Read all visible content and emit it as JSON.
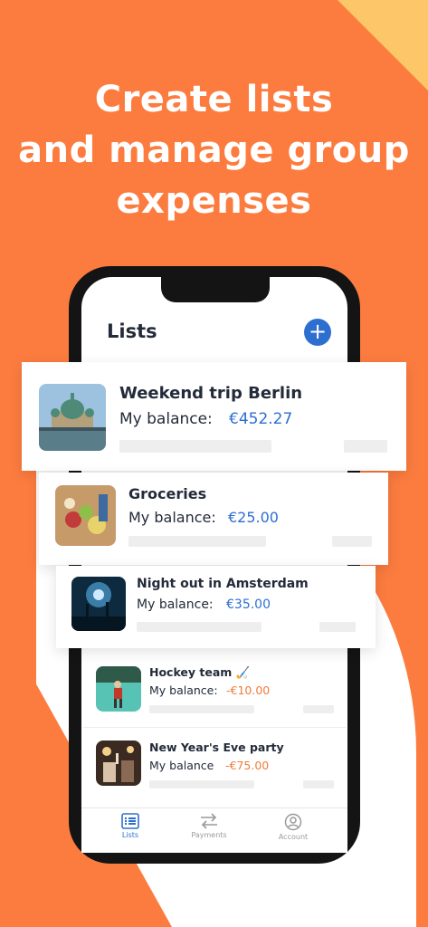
{
  "headline": [
    "Create lists",
    "and manage group",
    "expenses"
  ],
  "header": {
    "title": "Lists",
    "add_icon": "plus-icon"
  },
  "colors": {
    "background": "#fc7c3f",
    "accent": "#2d6fd1",
    "negative": "#f07b3a",
    "corner": "#fdc669"
  },
  "lists": [
    {
      "title": "Weekend trip Berlin",
      "balance_label": "My balance:",
      "balance_value": "€452.27",
      "sign": "positive",
      "image": "berlin-cathedral-photo"
    },
    {
      "title": "Groceries",
      "balance_label": "My balance:",
      "balance_value": "€25.00",
      "sign": "positive",
      "image": "groceries-basket-photo"
    },
    {
      "title": "Night out in Amsterdam",
      "balance_label": "My balance:",
      "balance_value": "€35.00",
      "sign": "positive",
      "image": "concert-crowd-photo"
    },
    {
      "title": "Hockey team 🏑",
      "balance_label": "My balance:",
      "balance_value": "-€10.00",
      "sign": "negative",
      "image": "hockey-player-photo"
    },
    {
      "title": "New Year's Eve party",
      "balance_label": "My balance",
      "balance_value": "-€75.00",
      "sign": "negative",
      "image": "party-photo"
    }
  ],
  "tabs": [
    {
      "label": "Lists",
      "icon": "list-icon",
      "active": true
    },
    {
      "label": "Payments",
      "icon": "transfer-arrows-icon",
      "active": false
    },
    {
      "label": "Account",
      "icon": "user-circle-icon",
      "active": false
    }
  ]
}
